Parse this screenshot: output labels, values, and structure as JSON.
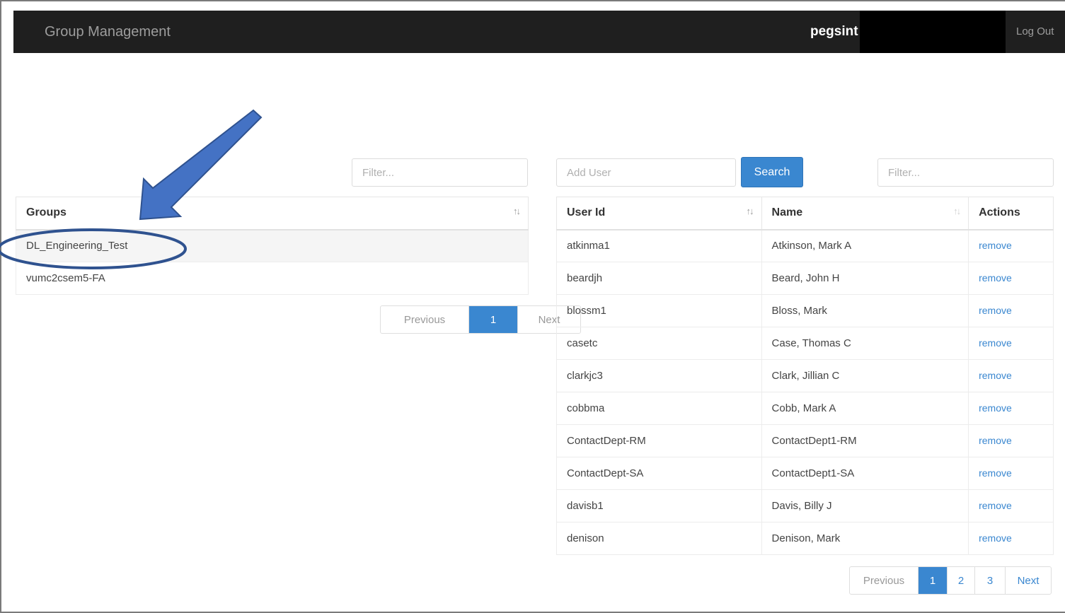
{
  "navbar": {
    "brand": "Group Management",
    "user": "pegsint",
    "logout_label": "Log Out"
  },
  "groups_panel": {
    "filter_placeholder": "Filter...",
    "header": "Groups",
    "rows": [
      "DL_Engineering_Test",
      "vumc2csem5-FA"
    ],
    "selected_index": 0,
    "pagination": {
      "previous": "Previous",
      "pages": [
        "1"
      ],
      "active": "1",
      "next": "Next"
    }
  },
  "users_panel": {
    "add_user_placeholder": "Add User",
    "search_label": "Search",
    "filter_placeholder": "Filter...",
    "headers": {
      "user_id": "User Id",
      "name": "Name",
      "actions": "Actions"
    },
    "rows": [
      {
        "user_id": "atkinma1",
        "name": "Atkinson, Mark A",
        "action": "remove"
      },
      {
        "user_id": "beardjh",
        "name": "Beard, John H",
        "action": "remove"
      },
      {
        "user_id": "blossm1",
        "name": "Bloss, Mark",
        "action": "remove"
      },
      {
        "user_id": "casetc",
        "name": "Case, Thomas C",
        "action": "remove"
      },
      {
        "user_id": "clarkjc3",
        "name": "Clark, Jillian C",
        "action": "remove"
      },
      {
        "user_id": "cobbma",
        "name": "Cobb, Mark A",
        "action": "remove"
      },
      {
        "user_id": "ContactDept-RM",
        "name": "ContactDept1-RM",
        "action": "remove"
      },
      {
        "user_id": "ContactDept-SA",
        "name": "ContactDept1-SA",
        "action": "remove"
      },
      {
        "user_id": "davisb1",
        "name": "Davis, Billy J",
        "action": "remove"
      },
      {
        "user_id": "denison",
        "name": "Denison, Mark",
        "action": "remove"
      }
    ],
    "pagination": {
      "previous": "Previous",
      "pages": [
        "1",
        "2",
        "3"
      ],
      "active": "1",
      "next": "Next"
    }
  },
  "icons": {
    "sort": "sort-icon",
    "arrow": "annotation-arrow",
    "ellipse": "annotation-ellipse"
  },
  "colors": {
    "navbar": "#1f1f1f",
    "accent": "#3a87d0",
    "annotation": "#4472c4"
  }
}
